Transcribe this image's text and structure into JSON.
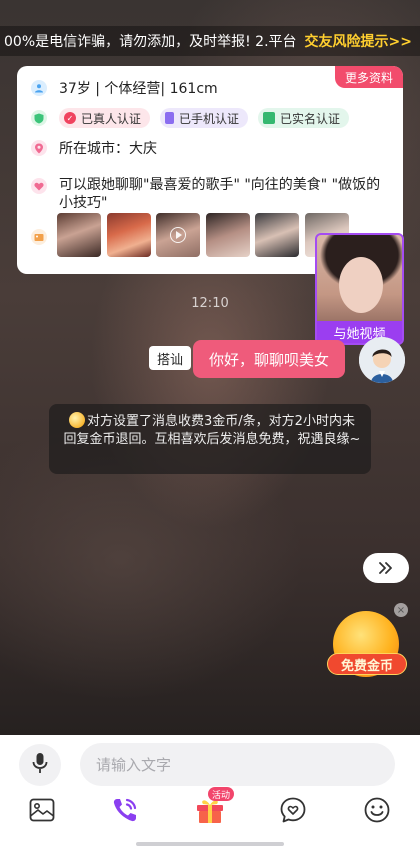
{
  "marquee": {
    "text": "00%是电信诈骗，请勿添加，及时举报! 2.平台",
    "link": "交友风险提示>>"
  },
  "profile_card": {
    "more_label": "更多资料",
    "info": "37岁 | 个体经营| 161cm",
    "badges": [
      "已真人认证",
      "已手机认证",
      "已实名认证"
    ],
    "city": "所在城市：大庆",
    "topics": "可以跟她聊聊\"最喜爱的歌手\" \"向往的美食\" \"做饭的小技巧\""
  },
  "video": {
    "label": "与她视频"
  },
  "chat": {
    "time": "12:10",
    "accost_tag": "搭讪",
    "message": "你好，聊聊呗美女",
    "system_notice": "对方设置了消息收费3金币/条，对方2小时内未回复金币退回。互相喜欢后发消息免费，祝遇良缘~"
  },
  "promo": {
    "label": "免费金币",
    "close": "×"
  },
  "input_bar": {
    "placeholder": "请输入文字"
  },
  "toolbar": {
    "activity_tag": "活动"
  },
  "icons": {
    "scroll": "double-chevron-right-icon",
    "mic": "microphone-icon",
    "image": "image-icon",
    "call": "phone-call-icon",
    "gift": "gift-icon",
    "chat": "heart-chat-icon",
    "emoji": "smiley-icon"
  },
  "colors": {
    "accent_pink": "#ef5b7b",
    "video_purple": "#9b3ef0",
    "warning_yellow": "#ffcf2f"
  }
}
